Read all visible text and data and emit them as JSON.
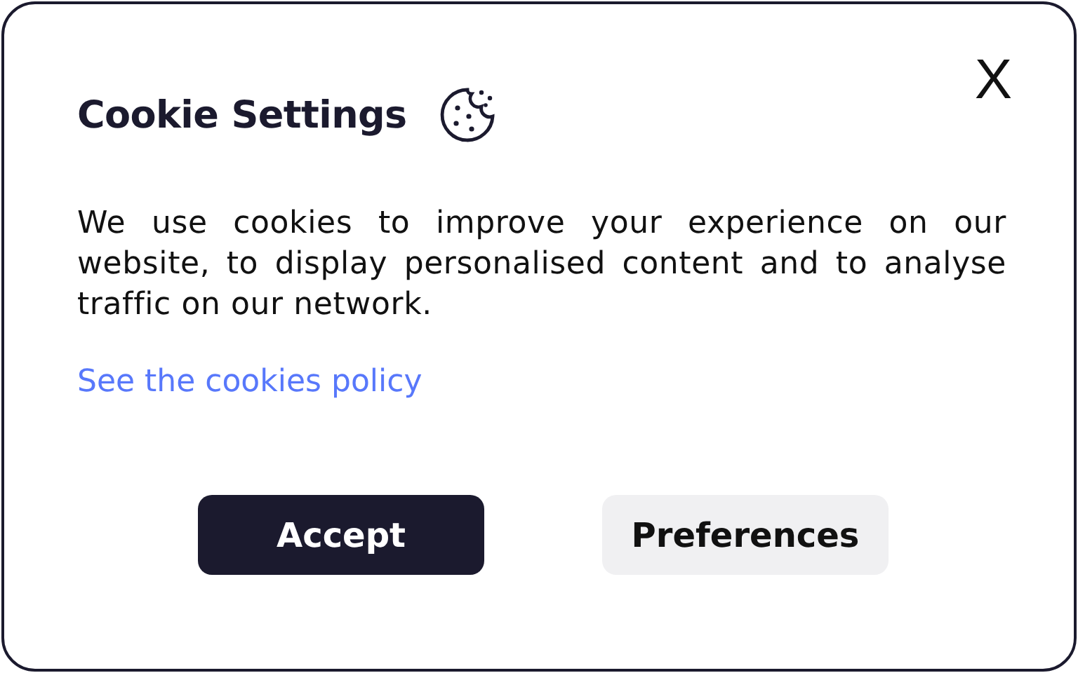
{
  "dialog": {
    "title": "Cookie Settings",
    "close": "X",
    "message": "We use cookies to improve your experience on our website, to display personalised content and to analyse traffic on our network.",
    "link": "See the cookies policy",
    "buttons": [
      {
        "label": "Accept",
        "kind": "primary"
      },
      {
        "label": "Preferences",
        "kind": "secondary"
      }
    ]
  }
}
